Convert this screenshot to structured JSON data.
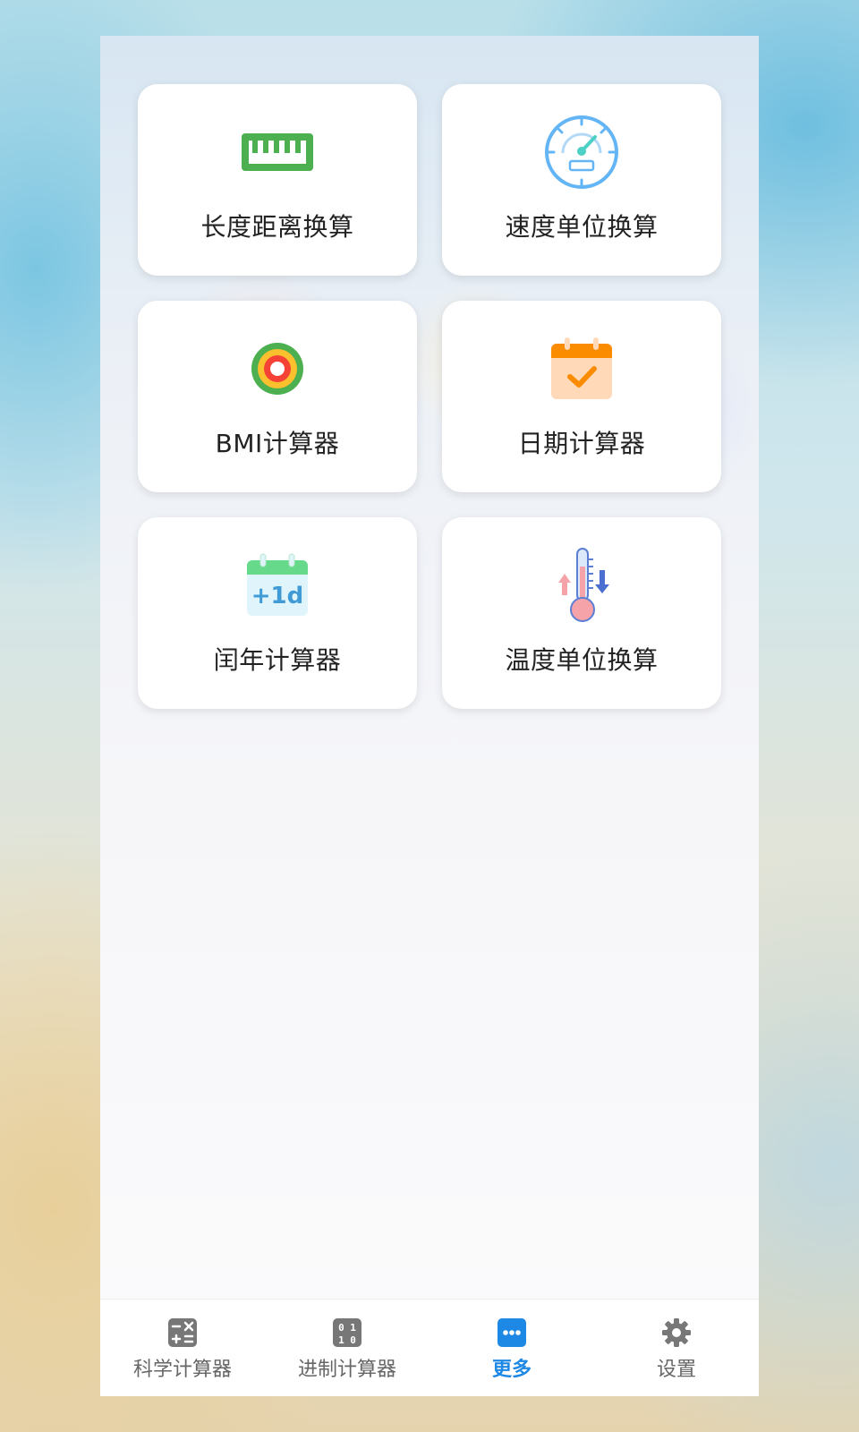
{
  "grid": {
    "items": [
      {
        "label": "长度距离换算",
        "icon": "ruler-icon"
      },
      {
        "label": "速度单位换算",
        "icon": "speedometer-icon"
      },
      {
        "label": "BMI计算器",
        "icon": "target-icon"
      },
      {
        "label": "日期计算器",
        "icon": "calendar-check-icon"
      },
      {
        "label": "闰年计算器",
        "icon": "calendar-plus-1d-icon",
        "icon_text": "+1d"
      },
      {
        "label": "温度单位换算",
        "icon": "thermometer-icon"
      }
    ]
  },
  "tabbar": {
    "items": [
      {
        "label": "科学计算器",
        "icon": "calculator-icon"
      },
      {
        "label": "进制计算器",
        "icon": "binary-icon",
        "icon_text": "0 1 1 0"
      },
      {
        "label": "更多",
        "icon": "more-icon",
        "active": true
      },
      {
        "label": "设置",
        "icon": "gear-icon"
      }
    ]
  },
  "colors": {
    "accent": "#1e88e5",
    "ruler": "#4caf50",
    "speed": "#64b5f6",
    "calendar_orange": "#fb8c00",
    "leap_green": "#66d98a"
  }
}
